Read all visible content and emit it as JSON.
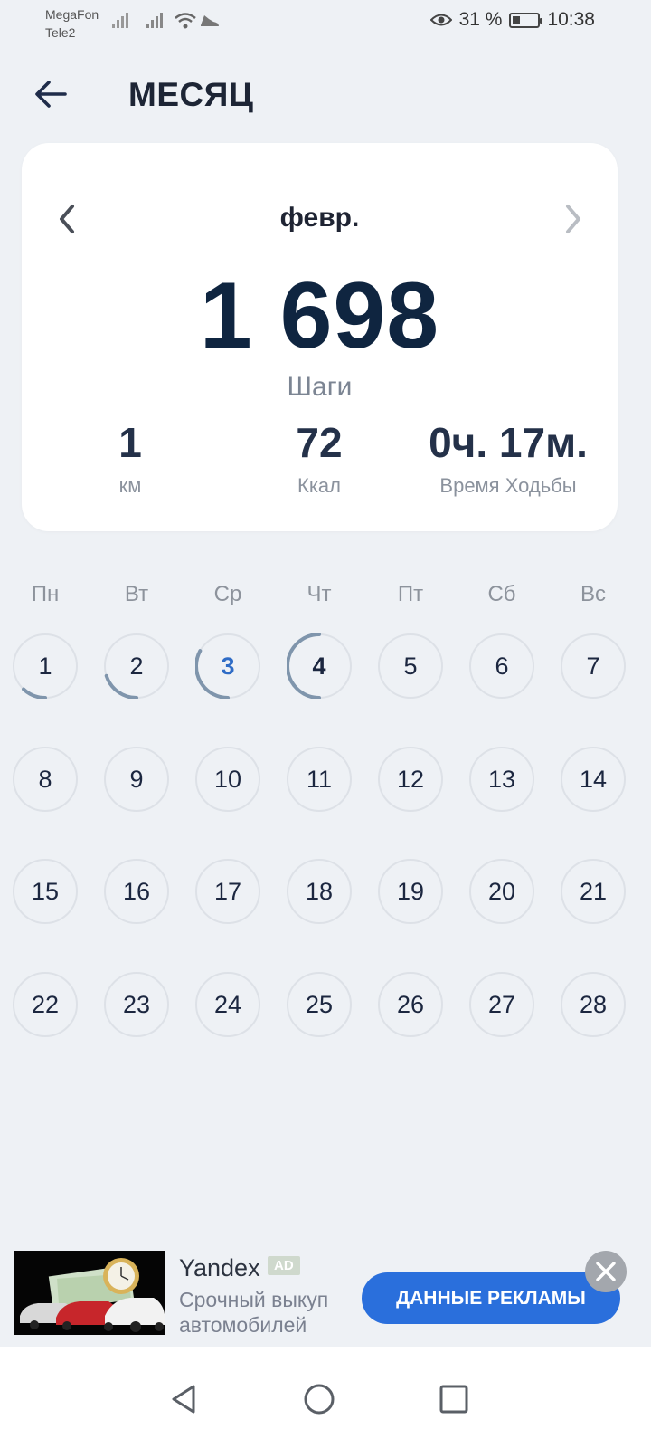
{
  "status_bar": {
    "carrier_1": "MegaFon",
    "carrier_2": "Tele2",
    "battery_text": "31 %",
    "battery_level": 0.31,
    "time": "10:38",
    "icons": [
      "signal-icon",
      "signal-icon",
      "wifi-icon",
      "shoe-icon",
      "eye-icon",
      "battery-icon"
    ]
  },
  "header": {
    "title": "МЕСЯЦ",
    "back_icon": "arrow-left-icon"
  },
  "summary": {
    "month": "февр.",
    "steps": "1 698",
    "steps_label": "Шаги",
    "stats": [
      {
        "value": "1",
        "label": "км"
      },
      {
        "value": "72",
        "label": "Ккал"
      },
      {
        "value": "0ч. 17м.",
        "label": "Время Ходьбы"
      }
    ]
  },
  "calendar": {
    "weekdays": [
      "Пн",
      "Вт",
      "Ср",
      "Чт",
      "Пт",
      "Сб",
      "Вс"
    ],
    "days": [
      "1",
      "2",
      "3",
      "4",
      "5",
      "6",
      "7",
      "8",
      "9",
      "10",
      "11",
      "12",
      "13",
      "14",
      "15",
      "16",
      "17",
      "18",
      "19",
      "20",
      "21",
      "22",
      "23",
      "24",
      "25",
      "26",
      "27",
      "28"
    ],
    "today": "3",
    "progress": {
      "1": 0.12,
      "2": 0.2,
      "3": 0.33,
      "4": 0.5
    }
  },
  "ad": {
    "brand": "Yandex",
    "badge": "AD",
    "text_line_1": "Срочный выкуп",
    "text_line_2": "автомобилей",
    "button": "ДАННЫЕ РЕКЛАМЫ"
  },
  "colors": {
    "accent": "#2a6fdc",
    "progress_ring": "#7f95ac",
    "today_text": "#2f6cc6"
  }
}
